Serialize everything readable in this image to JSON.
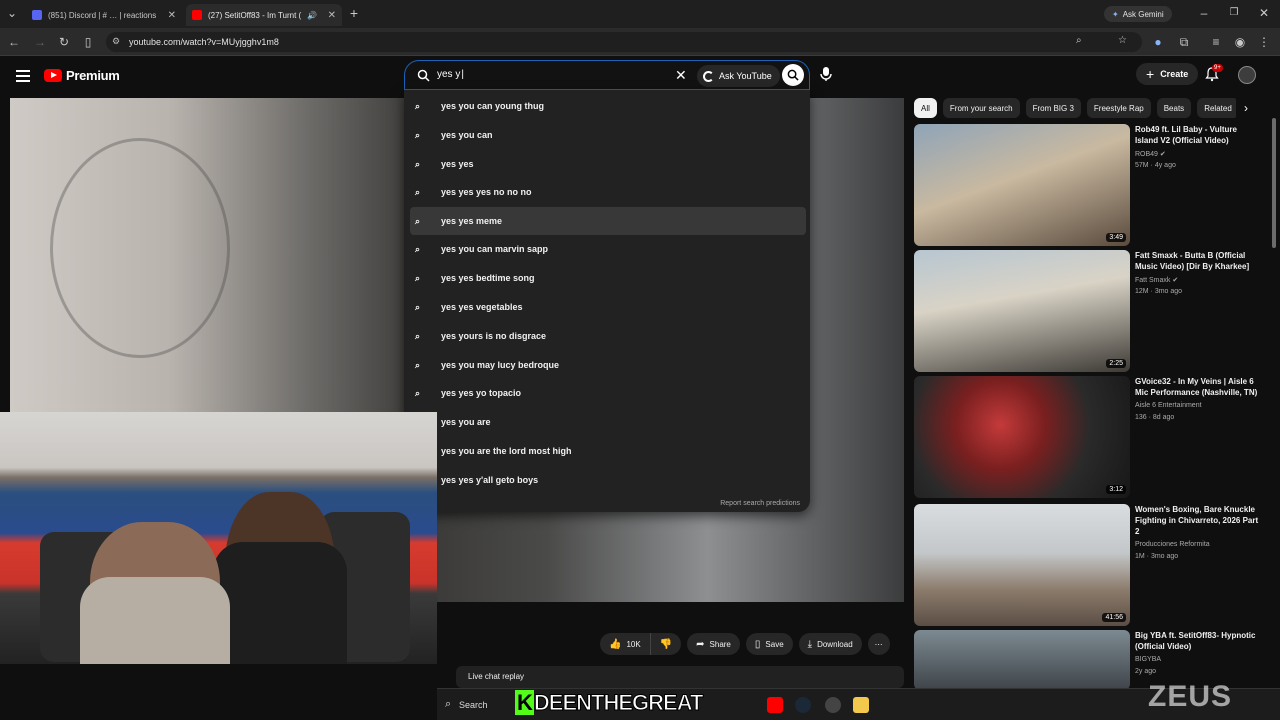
{
  "browser": {
    "tabs": [
      {
        "title": "(851) Discord | # … | reactions"
      },
      {
        "title": "(27) SetitOff83 - Im Turnt ("
      }
    ],
    "url": "youtube.com/watch?v=MUyjgghv1m8",
    "ask_gemini": "Ask Gemini"
  },
  "youtube": {
    "logo_text": "Premium",
    "search": {
      "query": "yes y",
      "ask_youtube": "Ask YouTube"
    },
    "create_label": "Create",
    "notification_count": "9+",
    "suggestions": [
      "yes you can young thug",
      "yes you can",
      "yes yes",
      "yes yes yes no no no",
      "yes yes meme",
      "yes you can marvin sapp",
      "yes yes bedtime song",
      "yes yes vegetables",
      "yes yours is no disgrace",
      "yes you may lucy bedroque",
      "yes yes yo topacio",
      "yes you are",
      "yes you are the lord most high",
      "yes yes y'all geto boys"
    ],
    "report_predictions": "Report search predictions",
    "actions": {
      "likes": "10K",
      "share": "Share",
      "save": "Save",
      "download": "Download"
    },
    "live_chat": "Live chat replay",
    "chips": [
      "All",
      "From your search",
      "From BIG 3",
      "Freestyle Rap",
      "Beats",
      "Related"
    ],
    "recommended": [
      {
        "title": "Rob49 ft. Lil Baby - Vulture Island V2 (Official Video)",
        "channel": "ROB49",
        "meta": "57M · 4y ago",
        "duration": "3:49",
        "verified": true
      },
      {
        "title": "Fatt Smaxk - Butta B (Official Music Video) [Dir By Kharkee]",
        "channel": "Fatt Smaxk",
        "meta": "12M · 3mo ago",
        "duration": "2:25",
        "verified": true
      },
      {
        "title": "GVoice32 - In My Veins | Aisle 6 Mic Performance (Nashville, TN)",
        "channel": "Aisle 6 Entertainment",
        "meta": "136 · 8d ago",
        "duration": "3:12",
        "verified": false
      },
      {
        "title": "Women's Boxing, Bare Knuckle Fighting in Chivarreto, 2026 Part 2",
        "channel": "Producciones Reformita",
        "meta": "1M · 3mo ago",
        "duration": "41:56",
        "verified": false
      },
      {
        "title": "Big YBA ft. SetitOff83- Hypnotic (Official Video)",
        "channel": "BIGYBA",
        "meta": "2y ago",
        "duration": "",
        "verified": false
      }
    ]
  },
  "overlay": {
    "streamer_name_k": "K",
    "streamer_name": "DEENTHEGREAT",
    "watermark": "ZEUS"
  },
  "taskbar": {
    "search": "Search"
  },
  "colors": {
    "yt_red": "#ff0000",
    "kick_green": "#53fc18",
    "background": "#0f0f0f"
  }
}
